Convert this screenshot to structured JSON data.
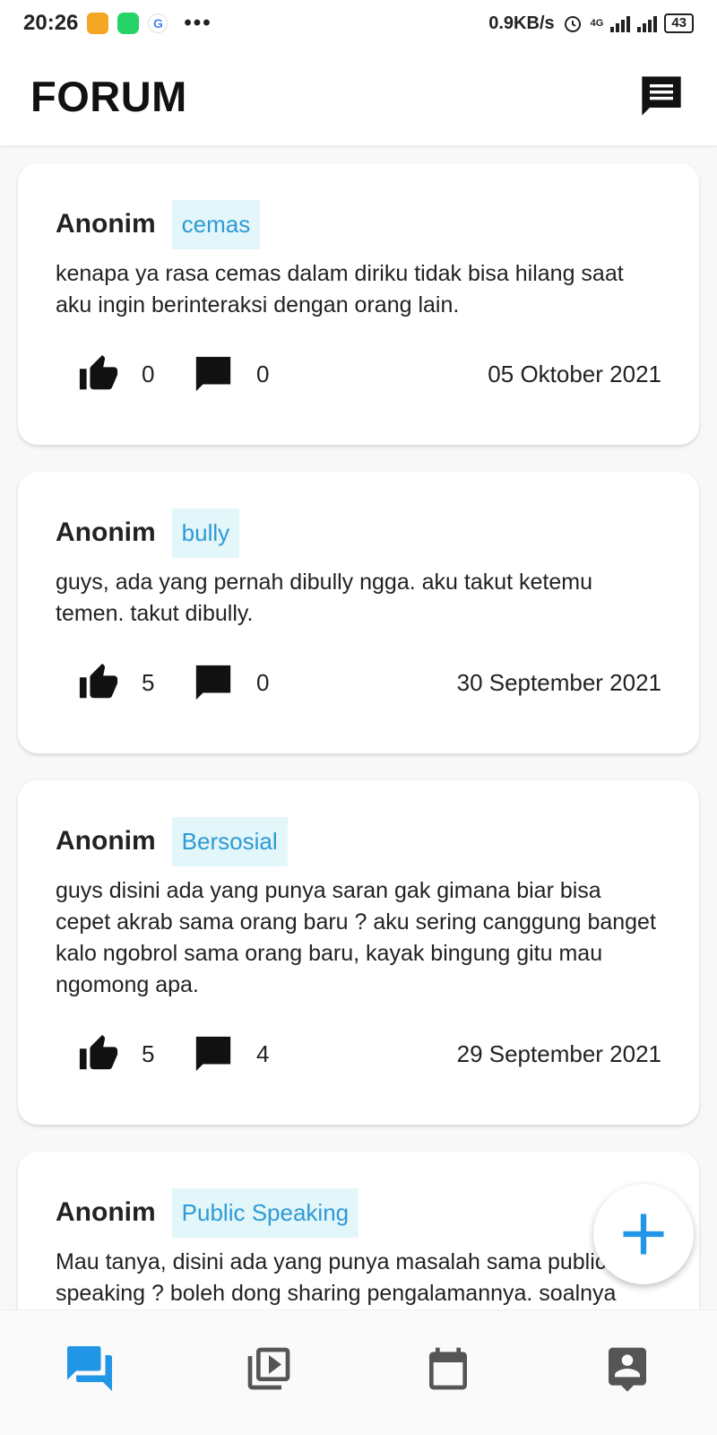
{
  "status_bar": {
    "time": "20:26",
    "net_speed": "0.9KB/s",
    "network": "4G",
    "battery": "43"
  },
  "header": {
    "title": "FORUM",
    "action_icon": "chat-icon"
  },
  "posts": [
    {
      "author": "Anonim",
      "tag": "cemas",
      "body": "kenapa ya rasa cemas dalam diriku tidak bisa hilang saat aku ingin berinteraksi dengan orang lain.",
      "likes": "0",
      "comments": "0",
      "date": "05 Oktober 2021"
    },
    {
      "author": "Anonim",
      "tag": "bully",
      "body": "guys, ada yang pernah dibully ngga. aku takut ketemu temen. takut dibully.",
      "likes": "5",
      "comments": "0",
      "date": "30 September 2021"
    },
    {
      "author": "Anonim",
      "tag": "Bersosial",
      "body": "guys disini ada yang punya saran gak gimana biar bisa cepet akrab sama orang baru ? aku sering canggung banget kalo ngobrol sama orang baru, kayak bingung gitu mau ngomong apa.",
      "likes": "5",
      "comments": "4",
      "date": "29 September 2021"
    },
    {
      "author": "Anonim",
      "tag": "Public Speaking",
      "body": "Mau tanya, disini ada yang punya masalah sama public speaking ? boleh dong sharing pengalamannya. soalnya",
      "likes": "",
      "comments": "",
      "date": ""
    }
  ],
  "fab": {
    "icon": "plus-icon"
  },
  "bottom_nav": [
    {
      "icon": "forum-icon",
      "active": true
    },
    {
      "icon": "video-library-icon",
      "active": false
    },
    {
      "icon": "calendar-icon",
      "active": false
    },
    {
      "icon": "contact-icon",
      "active": false
    }
  ],
  "colors": {
    "accent": "#2196e6",
    "tag_bg": "#e3f6f9",
    "tag_text": "#2e9ad6",
    "inactive_icon": "#555555"
  }
}
